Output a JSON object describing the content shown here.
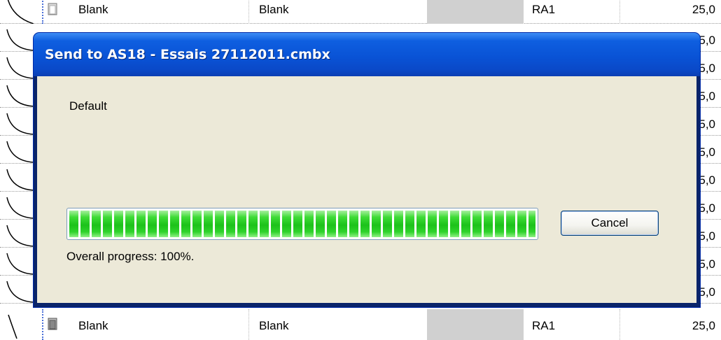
{
  "dialog": {
    "title": "Send to AS18 - Essais 27112011.cmbx",
    "profile": "Default",
    "progress_percent": 100,
    "cancel_label": "Cancel",
    "overall_progress_text": "Overall progress: 100%."
  },
  "background_table": {
    "rows": [
      {
        "col1": "Blank",
        "col2": "Blank",
        "col4": "RA1",
        "col5": "25,0"
      },
      {
        "col1": "",
        "col2": "",
        "col4": "",
        "col5": "5,0"
      },
      {
        "col1": "",
        "col2": "",
        "col4": "",
        "col5": "5,0"
      },
      {
        "col1": "",
        "col2": "",
        "col4": "",
        "col5": "5,0"
      },
      {
        "col1": "",
        "col2": "",
        "col4": "",
        "col5": "5,0"
      },
      {
        "col1": "",
        "col2": "",
        "col4": "",
        "col5": "5,0"
      },
      {
        "col1": "",
        "col2": "",
        "col4": "",
        "col5": "5,0"
      },
      {
        "col1": "",
        "col2": "",
        "col4": "",
        "col5": "5,0"
      },
      {
        "col1": "",
        "col2": "",
        "col4": "",
        "col5": "5,0"
      },
      {
        "col1": "",
        "col2": "",
        "col4": "",
        "col5": "5,0"
      },
      {
        "col1": "Blank",
        "col2": "Blank",
        "col4": "RA1",
        "col5": "25,0"
      }
    ]
  },
  "colors": {
    "titlebar": "#0953d6",
    "dialog_body": "#ece9d8",
    "progress_fill": "#1cc21a"
  }
}
